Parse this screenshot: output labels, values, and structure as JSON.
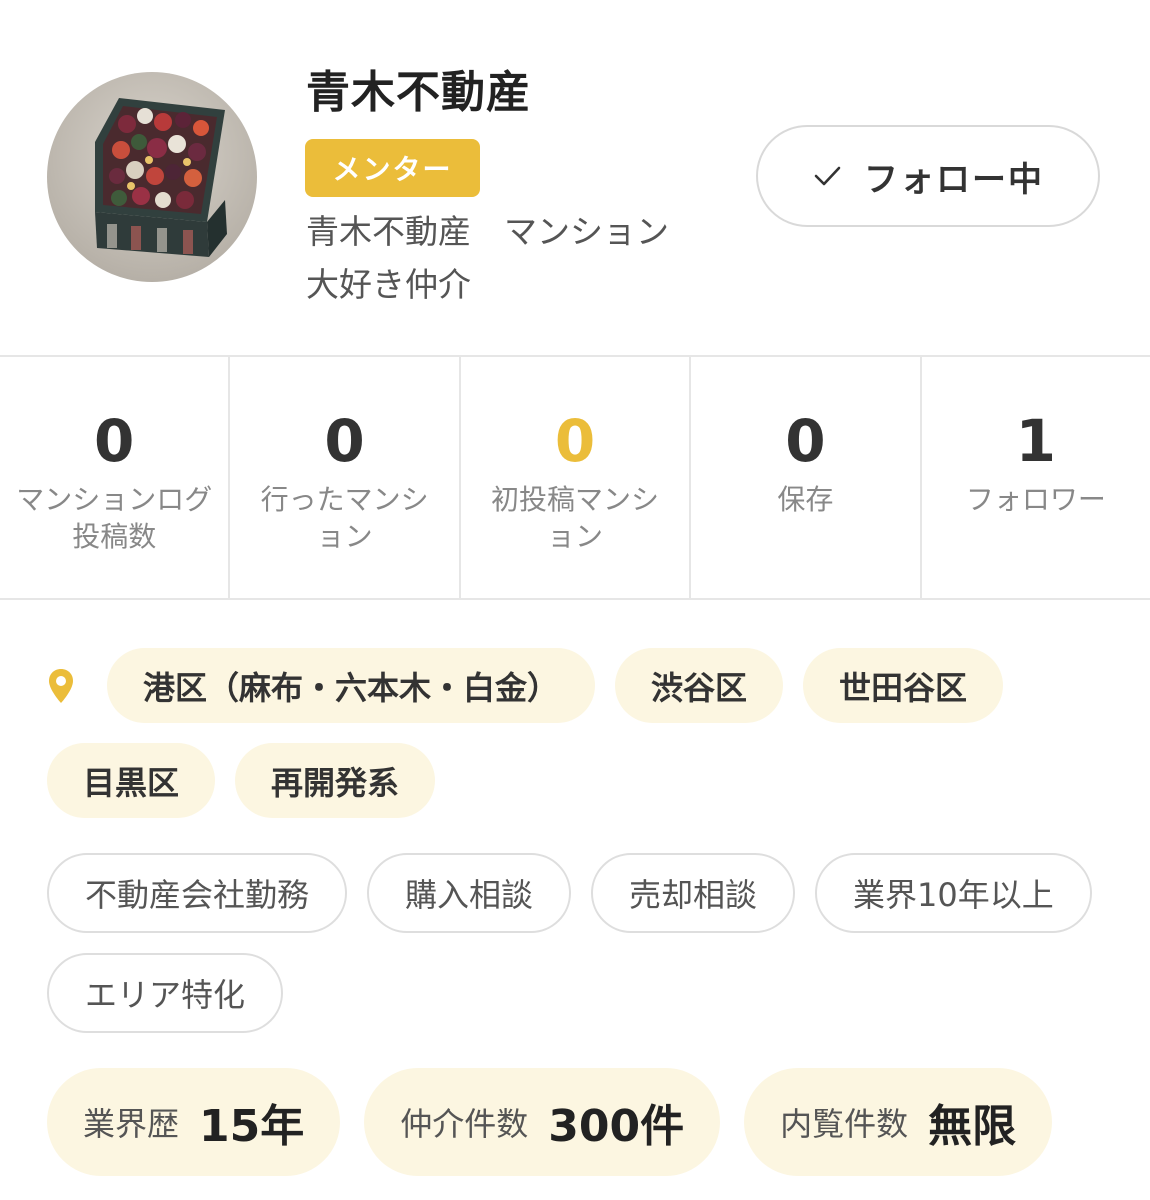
{
  "profile": {
    "name": "青木不動産",
    "badge": "メンター",
    "bio": "青木不動産　マンション\n大好き仲介",
    "follow_button": "フォロー中",
    "avatar": "flower-box-photo"
  },
  "stats": [
    {
      "value": "0",
      "label": "マンションログ\n投稿数"
    },
    {
      "value": "0",
      "label": "行ったマンシ\nョン"
    },
    {
      "value": "0",
      "label": "初投稿マンシ\nョン",
      "accent": true
    },
    {
      "value": "0",
      "label": "保存"
    },
    {
      "value": "1",
      "label": "フォロワー"
    }
  ],
  "areas": {
    "icon": "location-pin-icon",
    "items": [
      "港区（麻布・六本木・白金）",
      "渋谷区",
      "世田谷区",
      "目黒区",
      "再開発系"
    ]
  },
  "skills": [
    "不動産会社勤務",
    "購入相談",
    "売却相談",
    "業界10年以上",
    "エリア特化"
  ],
  "metrics": [
    {
      "label": "業界歴",
      "value": "15年"
    },
    {
      "label": "仲介件数",
      "value": "300件"
    },
    {
      "label": "内覧件数",
      "value": "無限"
    }
  ],
  "colors": {
    "accent": "#ebbd3a",
    "chip_bg": "#fcf6e1",
    "border": "#e6e6e6",
    "text": "#333333",
    "muted": "#888888"
  }
}
